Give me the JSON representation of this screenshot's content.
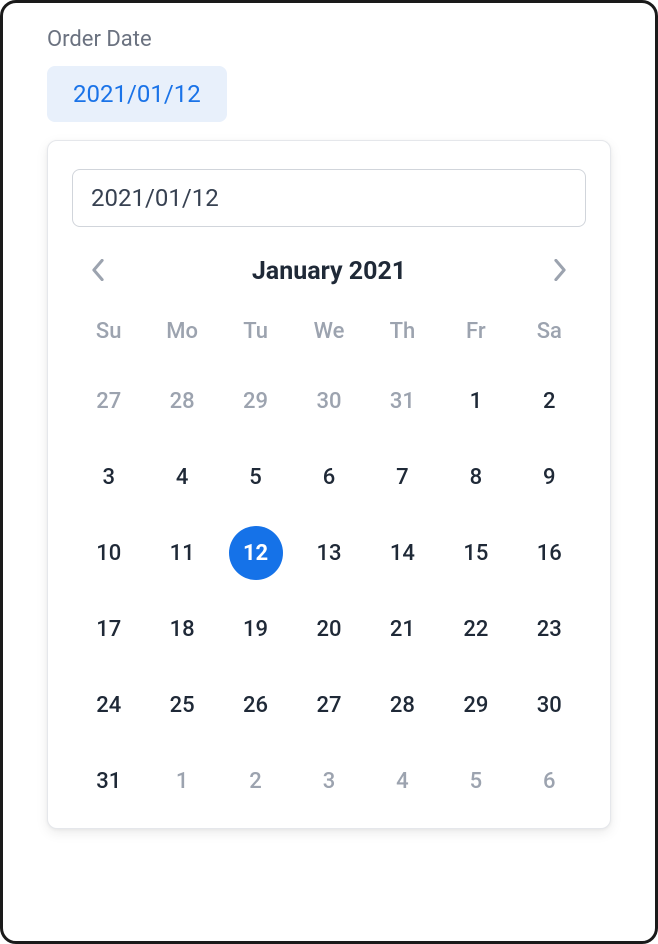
{
  "field_label": "Order Date",
  "selected_date_display": "2021/01/12",
  "calendar": {
    "input_value": "2021/01/12",
    "month_label": "January 2021",
    "weekday_headers": [
      "Su",
      "Mo",
      "Tu",
      "We",
      "Th",
      "Fr",
      "Sa"
    ],
    "weeks": [
      [
        {
          "n": "27",
          "outside": true,
          "selected": false
        },
        {
          "n": "28",
          "outside": true,
          "selected": false
        },
        {
          "n": "29",
          "outside": true,
          "selected": false
        },
        {
          "n": "30",
          "outside": true,
          "selected": false
        },
        {
          "n": "31",
          "outside": true,
          "selected": false
        },
        {
          "n": "1",
          "outside": false,
          "selected": false
        },
        {
          "n": "2",
          "outside": false,
          "selected": false
        }
      ],
      [
        {
          "n": "3",
          "outside": false,
          "selected": false
        },
        {
          "n": "4",
          "outside": false,
          "selected": false
        },
        {
          "n": "5",
          "outside": false,
          "selected": false
        },
        {
          "n": "6",
          "outside": false,
          "selected": false
        },
        {
          "n": "7",
          "outside": false,
          "selected": false
        },
        {
          "n": "8",
          "outside": false,
          "selected": false
        },
        {
          "n": "9",
          "outside": false,
          "selected": false
        }
      ],
      [
        {
          "n": "10",
          "outside": false,
          "selected": false
        },
        {
          "n": "11",
          "outside": false,
          "selected": false
        },
        {
          "n": "12",
          "outside": false,
          "selected": true
        },
        {
          "n": "13",
          "outside": false,
          "selected": false
        },
        {
          "n": "14",
          "outside": false,
          "selected": false
        },
        {
          "n": "15",
          "outside": false,
          "selected": false
        },
        {
          "n": "16",
          "outside": false,
          "selected": false
        }
      ],
      [
        {
          "n": "17",
          "outside": false,
          "selected": false
        },
        {
          "n": "18",
          "outside": false,
          "selected": false
        },
        {
          "n": "19",
          "outside": false,
          "selected": false
        },
        {
          "n": "20",
          "outside": false,
          "selected": false
        },
        {
          "n": "21",
          "outside": false,
          "selected": false
        },
        {
          "n": "22",
          "outside": false,
          "selected": false
        },
        {
          "n": "23",
          "outside": false,
          "selected": false
        }
      ],
      [
        {
          "n": "24",
          "outside": false,
          "selected": false
        },
        {
          "n": "25",
          "outside": false,
          "selected": false
        },
        {
          "n": "26",
          "outside": false,
          "selected": false
        },
        {
          "n": "27",
          "outside": false,
          "selected": false
        },
        {
          "n": "28",
          "outside": false,
          "selected": false
        },
        {
          "n": "29",
          "outside": false,
          "selected": false
        },
        {
          "n": "30",
          "outside": false,
          "selected": false
        }
      ],
      [
        {
          "n": "31",
          "outside": false,
          "selected": false
        },
        {
          "n": "1",
          "outside": true,
          "selected": false
        },
        {
          "n": "2",
          "outside": true,
          "selected": false
        },
        {
          "n": "3",
          "outside": true,
          "selected": false
        },
        {
          "n": "4",
          "outside": true,
          "selected": false
        },
        {
          "n": "5",
          "outside": true,
          "selected": false
        },
        {
          "n": "6",
          "outside": true,
          "selected": false
        }
      ]
    ]
  }
}
